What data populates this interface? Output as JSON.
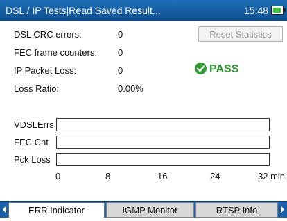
{
  "titlebar": {
    "title": "DSL / IP Tests|Read Saved Result...",
    "time": "15:48"
  },
  "stats": [
    {
      "label": "DSL CRC errors:",
      "value": "0"
    },
    {
      "label": "FEC frame counters:",
      "value": "0"
    },
    {
      "label": "IP Packet Loss:",
      "value": "0"
    },
    {
      "label": "Loss Ratio:",
      "value": "0.00%"
    }
  ],
  "reset_button_label": "Reset Statistics",
  "status": {
    "label": "PASS",
    "color": "#2f9a2f",
    "icon": "check-circle-icon"
  },
  "timeline": {
    "rows": [
      "VDSLErrs",
      "FEC Cnt",
      "Pck Loss"
    ],
    "ticks": [
      "0",
      "8",
      "16",
      "24",
      "32 min"
    ]
  },
  "tabs": [
    {
      "label": "ERR Indicator",
      "active": true
    },
    {
      "label": "IGMP Monitor",
      "active": false
    },
    {
      "label": "RTSP Info",
      "active": false
    }
  ],
  "colors": {
    "titlebar": "#1a5fa8",
    "battery": "#3cc23c",
    "tabbar": "#1a5fa8"
  }
}
